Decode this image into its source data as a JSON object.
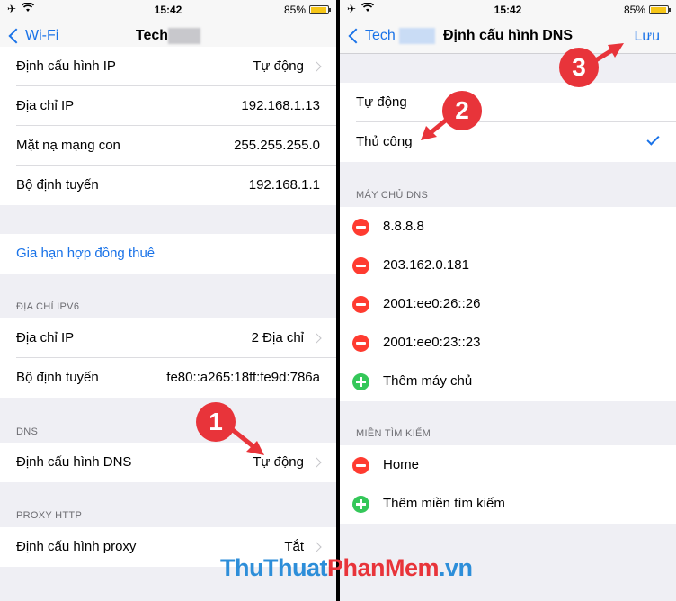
{
  "status": {
    "time": "15:42",
    "battery": "85%",
    "battery_level": 0.85
  },
  "left": {
    "nav": {
      "back_label": "Wi-Fi",
      "title": "Tech"
    },
    "rows_top": [
      {
        "label": "Định cấu hình IP",
        "value": "Tự động"
      },
      {
        "label": "Địa chỉ IP",
        "value": "192.168.1.13"
      },
      {
        "label": "Mặt nạ mạng con",
        "value": "255.255.255.0"
      },
      {
        "label": "Bộ định tuyến",
        "value": "192.168.1.1"
      }
    ],
    "renew_lease": "Gia hạn hợp đồng thuê",
    "ipv6_header": "ĐỊA CHỈ IPV6",
    "ipv6_rows": [
      {
        "label": "Địa chỉ IP",
        "value": "2 Địa chỉ"
      },
      {
        "label": "Bộ định tuyến",
        "value": "fe80::a265:18ff:fe9d:786a"
      }
    ],
    "dns_header": "DNS",
    "dns_row": {
      "label": "Định cấu hình DNS",
      "value": "Tự động"
    },
    "proxy_header": "PROXY HTTP",
    "proxy_row": {
      "label": "Định cấu hình proxy",
      "value": "Tắt"
    }
  },
  "right": {
    "nav": {
      "back_label": "Tech",
      "title": "Định cấu hình DNS",
      "action": "Lưu"
    },
    "modes": [
      "Tự động",
      "Thủ công"
    ],
    "selected_mode": "Thủ công",
    "dns_header": "MÁY CHỦ DNS",
    "dns_servers": [
      "8.8.8.8",
      "203.162.0.181",
      "2001:ee0:26::26",
      "2001:ee0:23::23"
    ],
    "add_server": "Thêm máy chủ",
    "search_header": "MIỀN TÌM KIẾM",
    "search_domains": [
      "Home"
    ],
    "add_search_domain": "Thêm miền tìm kiếm"
  },
  "annotations": {
    "step1": "1",
    "step2": "2",
    "step3": "3"
  },
  "watermark": {
    "part1": "ThuThuat",
    "part2": "PhanMem",
    "part3": ".vn"
  },
  "colors": {
    "accent": "#1a73e8",
    "delete": "#ff3b30",
    "add": "#34c759",
    "badge": "#e8343a"
  }
}
